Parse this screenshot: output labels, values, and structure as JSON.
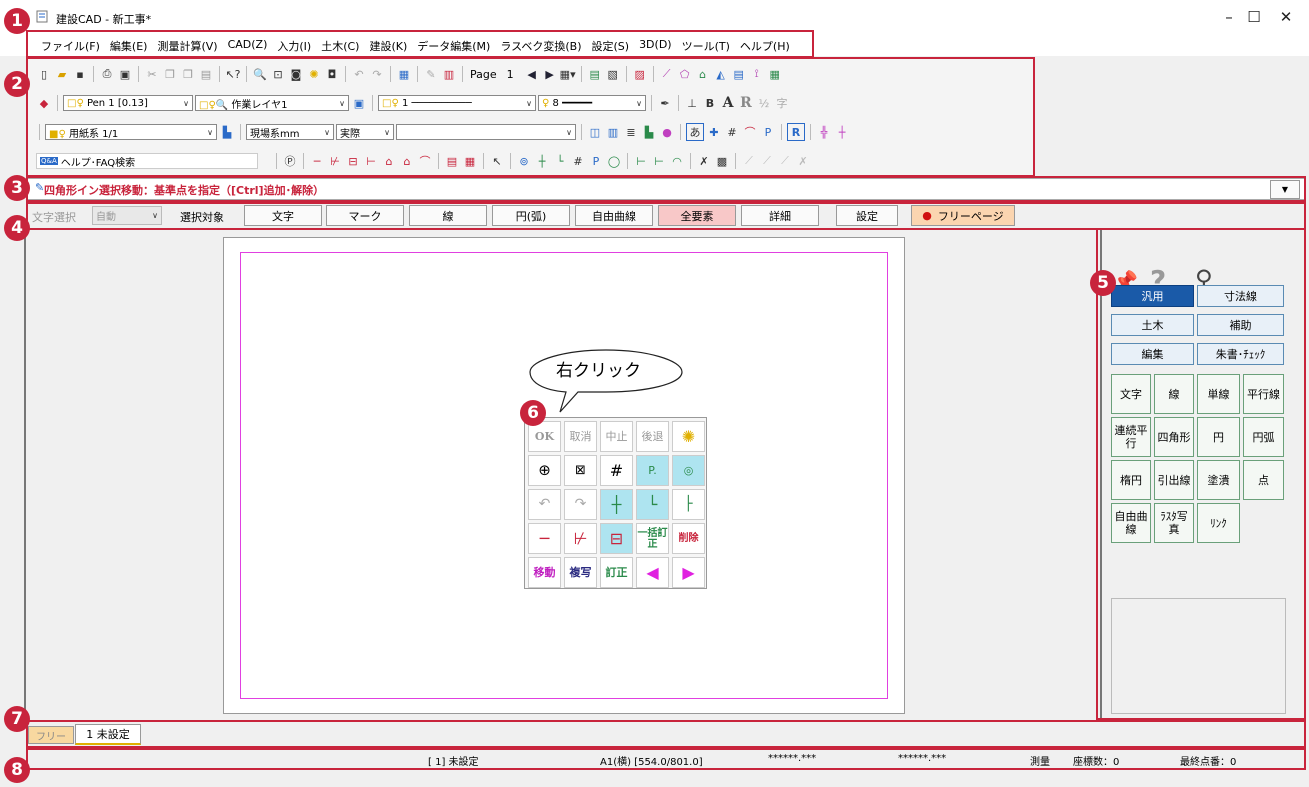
{
  "window": {
    "title": "建設CAD - 新工事*",
    "minimize": "–",
    "maximize": "☐",
    "close": "✕"
  },
  "menu": [
    "ファイル(F)",
    "編集(E)",
    "測量計算(V)",
    "CAD(Z)",
    "入力(I)",
    "土木(C)",
    "建設(K)",
    "データ編集(M)",
    "ラスベク変換(B)",
    "設定(S)",
    "3D(D)",
    "ツール(T)",
    "ヘルプ(H)"
  ],
  "toolbar": {
    "page_label": "Page",
    "page_num": "1",
    "pen": "Pen 1 [0.13]",
    "layer": "作業レイヤ1",
    "line_num": "1",
    "line_width": "8",
    "paper": "用紙系 1/1",
    "units": "現場系mm",
    "scale": "実際",
    "help_search": "ヘルプ･FAQ検索",
    "help_badge": "Q&A"
  },
  "command": {
    "text": "四角形イン選択移動：基準点を指定（[Ctrl]追加･解除）"
  },
  "options": {
    "text_select_label": "文字選択",
    "text_select_value": "自動",
    "target_label": "選択対象",
    "buttons": [
      "文字",
      "マーク",
      "線",
      "円(弧)",
      "自由曲線",
      "全要素",
      "詳細"
    ],
    "settings": "設定",
    "free_page": "フリーページ"
  },
  "callout": {
    "text": "右クリック"
  },
  "popup": {
    "row1": [
      "OK",
      "取消",
      "中止",
      "後退"
    ],
    "row5_labels": [
      "移動",
      "複写",
      "訂正"
    ],
    "row4_labels": [
      "一括訂正",
      "削除"
    ]
  },
  "palette": {
    "tabs": [
      "汎用",
      "寸法線",
      "土木",
      "補助",
      "編集",
      "朱書･ﾁｪｯｸ"
    ],
    "tools": [
      "文字",
      "線",
      "単線",
      "平行線",
      "連続平行",
      "四角形",
      "円",
      "円弧",
      "楕円",
      "引出線",
      "塗潰",
      "点",
      "自由曲線",
      "ﾗｽﾀ写真",
      "ﾘﾝｸ"
    ]
  },
  "tabs": {
    "free": "フリー",
    "sheet": "1 未設定"
  },
  "status": {
    "sheet": "[ 1] 未設定",
    "paper": "A1(横) [554.0/801.0]",
    "coord_x": "******.***",
    "coord_y": "******.***",
    "mode": "測量",
    "count": "座標数：0",
    "last_point": "最終点番：0"
  },
  "badges": [
    "1",
    "2",
    "3",
    "4",
    "5",
    "6",
    "7",
    "8"
  ],
  "colors": {
    "accent_red": "#c8243c",
    "frame_magenta": "#e040e0",
    "active_blue": "#1a5aa8"
  }
}
